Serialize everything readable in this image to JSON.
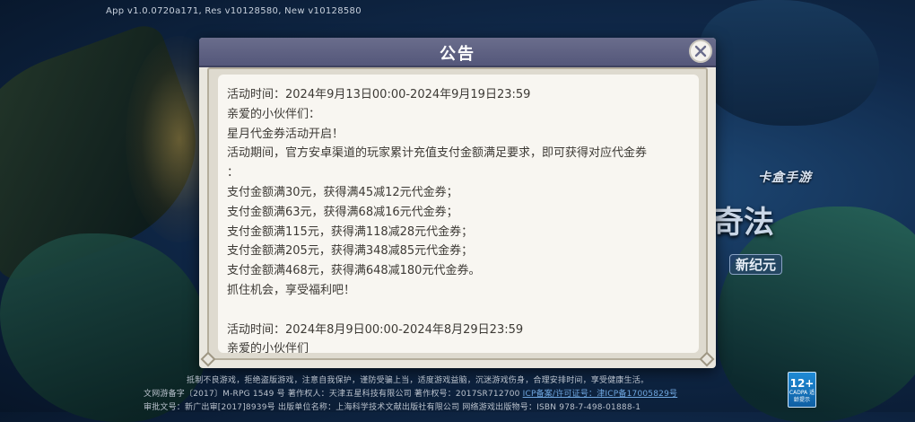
{
  "version_info": "App v1.0.0720a171, Res v10128580, New v10128580",
  "background_logo": {
    "tagline": "卡盒手游",
    "big_text": "奇法",
    "subtitle": "新纪元"
  },
  "dialog": {
    "title": "公告",
    "close_icon": "close-icon",
    "lines": [
      "活动时间：2024年9月13日00:00-2024年9月19日23:59",
      "亲爱的小伙伴们：",
      "星月代金券活动开启！",
      "活动期间，官方安卓渠道的玩家累计充值支付金额满足要求，即可获得对应代金券",
      "：",
      "支付金额满30元，获得满45减12元代金券；",
      "支付金额满63元，获得满68减16元代金券；",
      "支付金额满115元，获得满118减28元代金券；",
      "支付金额满205元，获得满348减85元代金券；",
      "支付金额满468元，获得满648减180元代金券。",
      "抓住机会，享受福利吧！",
      "",
      "活动时间：2024年8月9日00:00-2024年8月29日23:59",
      "亲爱的小伙伴们"
    ]
  },
  "footer": {
    "line1": "抵制不良游戏，拒绝盗版游戏，注意自我保护，谨防受骗上当，适度游戏益脑，沉迷游戏伤身，合理安排时间，享受健康生活。",
    "line2_prefix": "文网游备字〔2017〕M-RPG 1549 号 著作权人：天津五星科技有限公司 著作权号：2017SR712700",
    "line2_link": "ICP备案/许可证号：津ICP备17005829号",
    "line3": "审批文号：新广出审[2017]8939号 出版单位名称：上海科学技术文献出版社有限公司 网络游戏出版物号：ISBN 978-7-498-01888-1",
    "age_rating": "12+",
    "age_caption": "CADPA 适龄提示"
  }
}
